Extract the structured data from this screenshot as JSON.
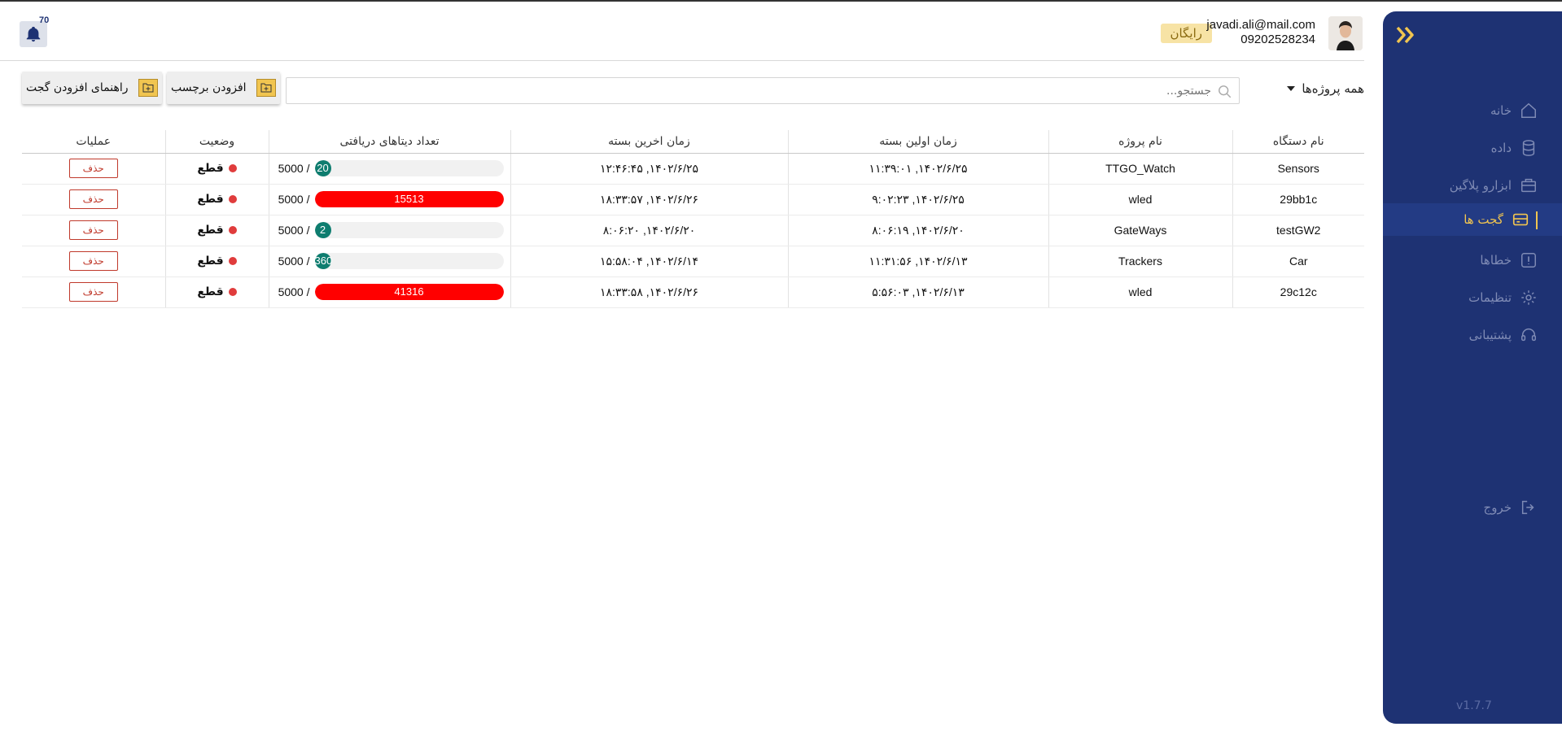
{
  "header": {
    "email": "javadi.ali@mail.com",
    "phone": "09202528234",
    "plan": "رایگان",
    "notifications": "70"
  },
  "toolbar": {
    "guide_button": "راهنمای افزودن گجت",
    "add_tag_button": "افزودن برچسب",
    "search_placeholder": "جستجو...",
    "project_filter": "همه پروژه‌ها"
  },
  "sidebar": {
    "items": [
      {
        "label": "خانه",
        "icon": "home-icon"
      },
      {
        "label": "داده",
        "icon": "database-icon"
      },
      {
        "label": "ابزارو پلاگین",
        "icon": "toolbox-icon"
      },
      {
        "label": "گجت ها",
        "icon": "gadget-icon",
        "active": true
      },
      {
        "label": "خطاها",
        "icon": "error-icon"
      },
      {
        "label": "تنظیمات",
        "icon": "gear-icon"
      },
      {
        "label": "پشتیبانی",
        "icon": "headset-icon"
      }
    ],
    "logout": "خروج",
    "version": "v1.7.7"
  },
  "table": {
    "headers": {
      "device": "نام دستگاه",
      "project": "نام پروژه",
      "first": "زمان اولین بسته",
      "last": "زمان اخرین بسته",
      "count": "تعداد دیتاهای دریافتی",
      "status": "وضعیت",
      "ops": "عملیات"
    },
    "limit_text": "5000 /",
    "delete_label": "حذف",
    "rows": [
      {
        "device": "Sensors",
        "project": "TTGO_Watch",
        "first": "۱۴۰۲/۶/۲۵, ۱۱:۳۹:۰۱",
        "last": "۱۴۰۲/۶/۲۵, ۱۲:۴۶:۴۵",
        "count": "20",
        "count_fraction": 0.004,
        "status": "قطع"
      },
      {
        "device": "29bb1c",
        "project": "wled",
        "first": "۱۴۰۲/۶/۲۵, ۹:۰۲:۲۳",
        "last": "۱۴۰۲/۶/۲۶, ۱۸:۳۳:۵۷",
        "count": "15513",
        "count_fraction": 1.0,
        "status": "قطع"
      },
      {
        "device": "testGW2",
        "project": "GateWays",
        "first": "۱۴۰۲/۶/۲۰, ۸:۰۶:۱۹",
        "last": "۱۴۰۲/۶/۲۰, ۸:۰۶:۲۰",
        "count": "2",
        "count_fraction": 0.0004,
        "status": "قطع"
      },
      {
        "device": "Car",
        "project": "Trackers",
        "first": "۱۴۰۲/۶/۱۳, ۱۱:۳۱:۵۶",
        "last": "۱۴۰۲/۶/۱۴, ۱۵:۵۸:۰۴",
        "count": "360",
        "count_fraction": 0.072,
        "status": "قطع"
      },
      {
        "device": "29c12c",
        "project": "wled",
        "first": "۱۴۰۲/۶/۱۳, ۵:۵۶:۰۳",
        "last": "۱۴۰۲/۶/۲۶, ۱۸:۳۳:۵۸",
        "count": "41316",
        "count_fraction": 1.0,
        "status": "قطع"
      }
    ]
  },
  "colors": {
    "sidebar_bg": "#1e3273",
    "accent": "#f1c550",
    "bar_ok": "#0e7d6f",
    "bar_over": "#ff0000",
    "status_off": "#e03c3c"
  }
}
